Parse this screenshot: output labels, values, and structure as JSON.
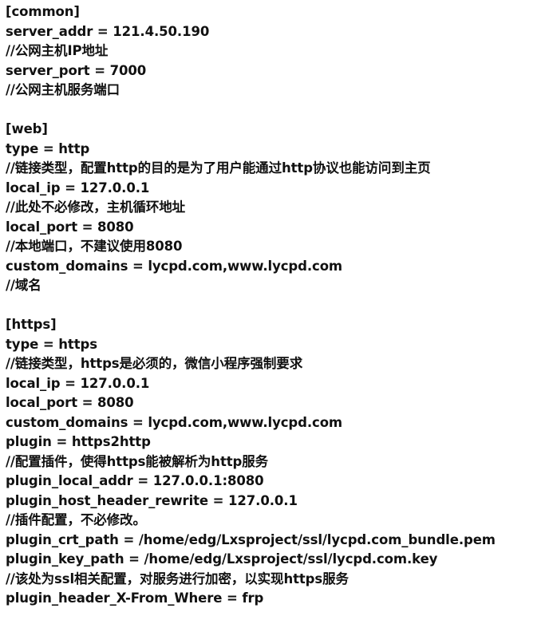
{
  "sections": [
    {
      "lines": [
        "[common]",
        "server_addr = 121.4.50.190",
        "//公网主机IP地址",
        "server_port = 7000",
        "//公网主机服务端口"
      ]
    },
    {
      "lines": [
        "[web]",
        "type = http",
        "//链接类型，配置http的目的是为了用户能通过http协议也能访问到主页",
        "local_ip = 127.0.0.1",
        "//此处不必修改，主机循环地址",
        "local_port = 8080",
        "//本地端口，不建议使用8080",
        "custom_domains = lycpd.com,www.lycpd.com",
        "//域名"
      ]
    },
    {
      "lines": [
        "[https]",
        "type = https",
        "//链接类型，https是必须的，微信小程序强制要求",
        "local_ip = 127.0.0.1",
        "local_port = 8080",
        "custom_domains = lycpd.com,www.lycpd.com",
        "plugin = https2http",
        "//配置插件，使得https能被解析为http服务",
        "plugin_local_addr = 127.0.0.1:8080",
        "plugin_host_header_rewrite = 127.0.0.1",
        "//插件配置，不必修改。",
        "plugin_crt_path = /home/edg/Lxsproject/ssl/lycpd.com_bundle.pem",
        "plugin_key_path = /home/edg/Lxsproject/ssl/lycpd.com.key",
        "//该处为ssl相关配置，对服务进行加密，以实现https服务",
        "plugin_header_X-From_Where = frp"
      ]
    }
  ]
}
